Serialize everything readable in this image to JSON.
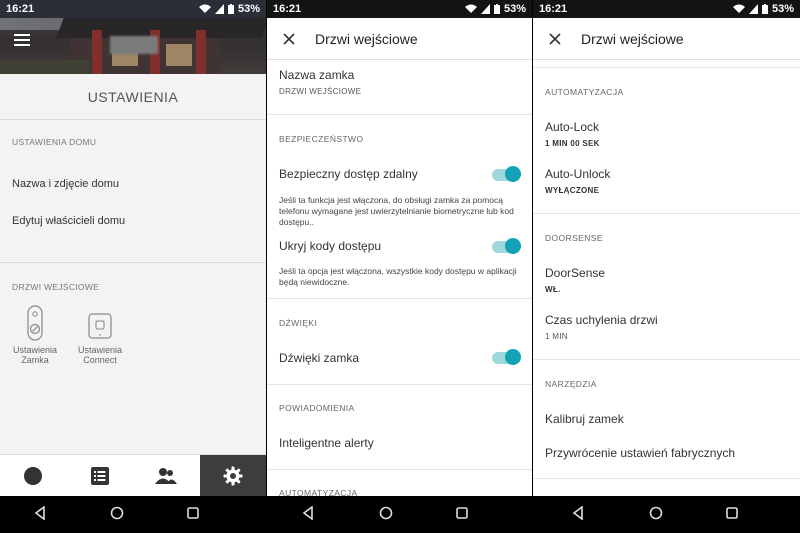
{
  "status": {
    "time": "16:21",
    "battery": "53%"
  },
  "panel1": {
    "title": "USTAWIENIA",
    "home_section_label": "USTAWIENIA DOMU",
    "home_items": [
      "Nazwa i zdjęcie domu",
      "Edytuj właścicieli domu"
    ],
    "door_section_label": "DRZWI WEJŚCIOWE",
    "devices": [
      {
        "line1": "Ustawienia",
        "line2": "Zamka"
      },
      {
        "line1": "Ustawienia",
        "line2": "Connect"
      }
    ],
    "bottom_nav": [
      "home-icon",
      "list-icon",
      "users-icon",
      "gear-icon"
    ]
  },
  "panel2": {
    "title": "Drzwi wejściowe",
    "lock_name_label": "Nazwa zamka",
    "lock_name_value": "DRZWI WEJŚCIOWE",
    "security_header": "BEZPIECZEŃSTWO",
    "remote_access": {
      "title": "Bezpieczny dostęp zdalny",
      "desc": "Jeśli ta funkcja jest włączona, do obsługi zamka za pomocą telefonu wymagane jest uwierzytelnianie biometryczne lub kod dostępu..",
      "on": true
    },
    "hide_codes": {
      "title": "Ukryj kody dostępu",
      "desc": "Jeśli ta opcja jest włączona, wszystkie kody dostępu w aplikacji będą niewidoczne.",
      "on": true
    },
    "sounds_header": "DŹWIĘKI",
    "lock_sounds": {
      "title": "Dźwięki zamka",
      "on": true
    },
    "notifications_header": "POWIADOMIENIA",
    "smart_alerts": "Inteligentne alerty",
    "automation_header": "AUTOMATYZACJA"
  },
  "panel3": {
    "title": "Drzwi wejściowe",
    "automation_header": "AUTOMATYZACJA",
    "auto_lock": {
      "title": "Auto-Lock",
      "value": "1 MIN 00 SEK"
    },
    "auto_unlock": {
      "title": "Auto-Unlock",
      "value": "WYŁĄCZONE"
    },
    "doorsense_header": "DOORSENSE",
    "doorsense": {
      "title": "DoorSense",
      "value": "WŁ."
    },
    "ajar_time": {
      "title": "Czas uchylenia drzwi",
      "value": "1 MIN"
    },
    "tools_header": "NARZĘDZIA",
    "calibrate": "Kalibruj zamek",
    "factory_reset": "Przywrócenie ustawień fabrycznych"
  },
  "colors": {
    "accent": "#14a3b4",
    "toggle_track": "#9fd8dc",
    "nav_active": "#3d3d3d"
  }
}
